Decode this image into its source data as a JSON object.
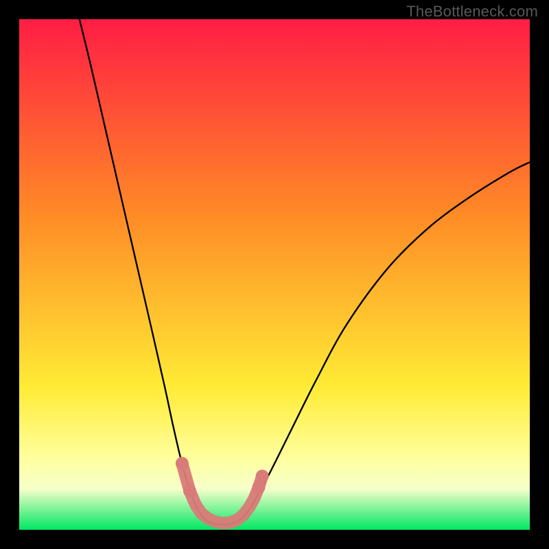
{
  "watermark": "TheBottleneck.com",
  "colors": {
    "bg": "#000000",
    "watermark": "#585858",
    "curve": "#000000",
    "marker": "#d97b78",
    "gradient_top": "#ff1d44",
    "gradient_mid1": "#ff8a26",
    "gradient_mid2": "#ffeb35",
    "gradient_mid3": "#ffff9e",
    "gradient_bottom": "#00e763"
  },
  "chart_data": {
    "type": "line",
    "title": "",
    "xlabel": "",
    "ylabel": "",
    "xlim": [
      0,
      100
    ],
    "ylim": [
      0,
      100
    ],
    "gradient_stops": [
      {
        "offset": 0.0,
        "color": "#ff1d44"
      },
      {
        "offset": 0.38,
        "color": "#ff8a26"
      },
      {
        "offset": 0.72,
        "color": "#ffeb35"
      },
      {
        "offset": 0.86,
        "color": "#ffff9e"
      },
      {
        "offset": 0.92,
        "color": "#f6ffca"
      },
      {
        "offset": 1.0,
        "color": "#00e763"
      }
    ],
    "curve_poly": [
      [
        11.8,
        100.0
      ],
      [
        14.0,
        91.0
      ],
      [
        17.0,
        78.0
      ],
      [
        20.0,
        65.0
      ],
      [
        23.0,
        52.0
      ],
      [
        26.0,
        39.0
      ],
      [
        28.5,
        28.0
      ],
      [
        30.0,
        21.0
      ],
      [
        31.5,
        14.5
      ],
      [
        33.0,
        9.0
      ],
      [
        34.5,
        5.0
      ],
      [
        36.0,
        2.4
      ],
      [
        38.0,
        1.2
      ],
      [
        40.0,
        1.0
      ],
      [
        42.0,
        1.3
      ],
      [
        44.0,
        2.6
      ],
      [
        46.0,
        5.5
      ],
      [
        49.0,
        11.0
      ],
      [
        53.0,
        19.0
      ],
      [
        58.0,
        29.0
      ],
      [
        64.0,
        40.0
      ],
      [
        72.0,
        51.0
      ],
      [
        80.0,
        59.0
      ],
      [
        88.0,
        65.0
      ],
      [
        96.0,
        70.0
      ],
      [
        100.0,
        72.0
      ]
    ],
    "markers": [
      [
        31.9,
        13.0
      ],
      [
        33.4,
        7.6
      ],
      [
        34.6,
        4.8
      ],
      [
        35.7,
        3.2
      ],
      [
        37.0,
        2.2
      ],
      [
        38.4,
        1.6
      ],
      [
        39.8,
        1.3
      ],
      [
        41.2,
        1.4
      ],
      [
        42.6,
        1.9
      ],
      [
        43.9,
        2.9
      ],
      [
        45.1,
        4.5
      ],
      [
        46.0,
        6.1
      ],
      [
        46.9,
        8.3
      ],
      [
        47.6,
        10.5
      ]
    ]
  }
}
